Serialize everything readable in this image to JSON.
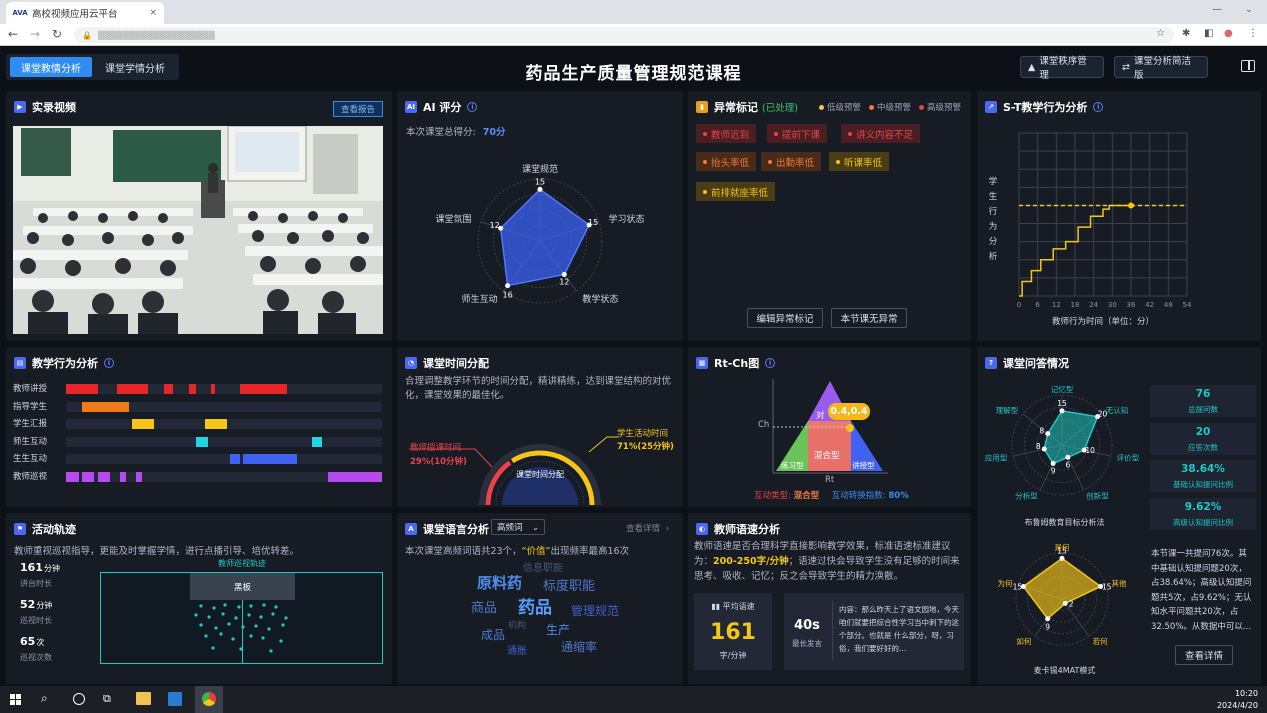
{
  "browser": {
    "tab_title": "高校视频应用云平台",
    "tab_logo": "AVA",
    "tab_close": "×",
    "url": "▒▒▒▒▒▒▒▒▒▒▒▒▒▒▒▒▒▒▒"
  },
  "header": {
    "tab_teaching": "课堂教情分析",
    "tab_learning": "课堂学情分析",
    "title": "药品生产质量管理规范课程",
    "btn_order": "课堂秩序管理",
    "btn_simple": "课堂分析简洁版"
  },
  "video": {
    "title": "实录视频",
    "report_button": "查看报告"
  },
  "ai_score": {
    "title": "AI 评分",
    "summary_prefix": "本次课堂总得分:",
    "score": "70分",
    "chart_data": {
      "type": "radar",
      "axes": [
        "课堂规范",
        "学习状态",
        "教学状态",
        "师生互动",
        "课堂氛围"
      ],
      "values": [
        15,
        15,
        12,
        16,
        12
      ],
      "labels": [
        "15",
        "15",
        "12",
        "16",
        "12"
      ]
    }
  },
  "anomaly": {
    "title": "异常标记",
    "handled": "(已处理)",
    "legend": [
      "低级预警",
      "中级预警",
      "高级预警"
    ],
    "legend_colors": [
      "#f5c84a",
      "#f07b3a",
      "#e54545"
    ],
    "tags": [
      "教师迟到",
      "提前下课",
      "讲义内容不足",
      "抬头率低",
      "出勤率低",
      "听课率低",
      "前排就座率低"
    ],
    "edit_button": "编辑异常标记",
    "no_anomaly_button": "本节课无异常"
  },
  "st": {
    "title": "S-T教学行为分析",
    "ylabel": "学生行为分析",
    "xlabel": "教师行为时间（单位：分）",
    "chart_data": {
      "type": "line",
      "x_ticks": [
        "0",
        "6",
        "12",
        "18",
        "24",
        "30",
        "36",
        "42",
        "48",
        "54"
      ],
      "y_ticks": [
        "0",
        "5",
        "10",
        "15",
        "20",
        "25",
        "30",
        "35",
        "40",
        "45"
      ],
      "xlim": [
        0,
        54
      ],
      "ylim": [
        0,
        45
      ],
      "series": [
        {
          "x": [
            0,
            1,
            1,
            4,
            4,
            7,
            7,
            11,
            11,
            15,
            15,
            19,
            19,
            23,
            23,
            27,
            27,
            29,
            29,
            31,
            31,
            36
          ],
          "y": [
            0,
            0,
            4,
            4,
            7,
            7,
            10,
            10,
            13,
            13,
            15,
            15,
            19,
            19,
            22,
            22,
            24,
            24,
            25,
            25,
            25,
            25
          ]
        }
      ],
      "reference_y": 25,
      "point": [
        36,
        25
      ]
    }
  },
  "behavior": {
    "title": "教学行为分析",
    "rows": [
      {
        "label": "教师讲授",
        "color": "#e8262a",
        "segments": [
          [
            0.0,
            0.1
          ],
          [
            0.16,
            0.26
          ],
          [
            0.31,
            0.34
          ],
          [
            0.39,
            0.41
          ],
          [
            0.46,
            0.47
          ],
          [
            0.55,
            0.7
          ]
        ]
      },
      {
        "label": "指导学生",
        "color": "#f07b1a",
        "segments": [
          [
            0.05,
            0.2
          ]
        ]
      },
      {
        "label": "学生汇报",
        "color": "#f5c518",
        "segments": [
          [
            0.21,
            0.28
          ],
          [
            0.44,
            0.51
          ]
        ]
      },
      {
        "label": "师生互动",
        "color": "#1ed6e0",
        "segments": [
          [
            0.41,
            0.45
          ],
          [
            0.78,
            0.81
          ]
        ]
      },
      {
        "label": "生生互动",
        "color": "#3f62f2",
        "segments": [
          [
            0.52,
            0.55
          ],
          [
            0.56,
            0.73
          ]
        ]
      },
      {
        "label": "教师巡视",
        "color": "#b848f0",
        "segments": [
          [
            0.0,
            0.04
          ],
          [
            0.05,
            0.09
          ],
          [
            0.1,
            0.14
          ],
          [
            0.17,
            0.19
          ],
          [
            0.22,
            0.24
          ],
          [
            0.83,
            1.0
          ]
        ]
      }
    ]
  },
  "time": {
    "title": "课堂时间分配",
    "desc": "合理调整教学环节的时间分配，精讲精练，达到课堂结构的对优化，课堂效果的最佳化。",
    "teacher_label": "教师授课时间",
    "teacher_value": "29%(10分钟)",
    "student_label": "学生活动时间",
    "student_value": "71%(25分钟)",
    "center": "课堂时间分配",
    "teacher_fraction": 0.29,
    "student_fraction": 0.71
  },
  "rtch": {
    "title": "Rt-Ch图",
    "ch": "Ch",
    "rt": "Rt",
    "pair": "对",
    "point": "0.4,0.4",
    "mixed": "混合型",
    "practice": "练习型",
    "lecture": "讲授型",
    "type_label": "互动类型:",
    "type_value": "混合型",
    "conv_label": "互动转换指数:",
    "conv_value": "80%"
  },
  "qa": {
    "title": "课堂问答情况",
    "bloom_axes": [
      "记忆型",
      "无认知",
      "评价型",
      "创新型",
      "分析型",
      "应用型",
      "理解型"
    ],
    "bloom_values": [
      "15",
      "20",
      "10",
      "6",
      "9",
      "8",
      "8"
    ],
    "bloom_caption": "布鲁姆教育目标分析法",
    "mcc_axes": [
      "是何",
      "其他",
      "若何",
      "如何",
      "为何"
    ],
    "mcc_values": [
      "15",
      "15",
      "2",
      "9",
      "15"
    ],
    "mcc_caption": "麦卡锡4MAT模式",
    "stats": [
      {
        "value": "76",
        "label": "总提问数"
      },
      {
        "value": "20",
        "label": "应答次数"
      },
      {
        "value": "38.64%",
        "label": "基础认知提问比例"
      },
      {
        "value": "9.62%",
        "label": "高级认知提问比例"
      }
    ],
    "summary": "本节课一共提问76次。其中基础认知提问题20次，占38.64%；高级认知提问题共5次，占9.62%；无认知水平问题共20次，占32.50%。从数据中可以...",
    "detail_button": "查看详情"
  },
  "track": {
    "title": "活动轨迹",
    "desc": "教师重视巡视指导，更能及时掌握学情，进行点播引导、培优转差。",
    "stats": [
      {
        "value": "161",
        "unit": "分钟",
        "label": "讲台时长"
      },
      {
        "value": "52",
        "unit": "分钟",
        "label": "巡视时长"
      },
      {
        "value": "65",
        "unit": "次",
        "label": "巡视次数"
      }
    ],
    "map_title": "教师巡视轨迹",
    "board": "黑板"
  },
  "language": {
    "title": "课堂语言分析",
    "select": "高频词",
    "detail_link": "查看详情",
    "desc_prefix": "本次课堂高频词语共23个，",
    "keyword": "“价值”",
    "desc_suffix": "出现频率最高16次",
    "words": [
      "信息职能",
      "原料药",
      "标度职能",
      "商品",
      "药品",
      "管理规范",
      "机构",
      "成品",
      "生产",
      "通胀",
      "通缩率"
    ]
  },
  "speed": {
    "title": "教师语速分析",
    "desc_a": "教师语速是否合理科学直接影响教学效果，标准语速标准建议为：",
    "desc_b": "200-250字/分钟",
    "desc_c": "；语速过快会导致学生没有足够的时间来思考、吸收、记忆；反之会导致学生的精力涣散。",
    "avg_label": "平均语速",
    "avg_value": "161",
    "avg_unit": "字/分钟",
    "max_value": "40s",
    "max_label": "最长发言",
    "content": "内容：那么昨天上了语文园地，今天咱们就要把综合性学习当中刺下的这个部分。也就是 什么部分，呀，习俗，我们要好好的..."
  },
  "taskbar": {
    "time": "10:20",
    "date": "2024/4/20"
  },
  "colors": {
    "accent_blue": "#2f8cf0",
    "gold": "#f5c518",
    "cyan": "#1fc8c8"
  }
}
